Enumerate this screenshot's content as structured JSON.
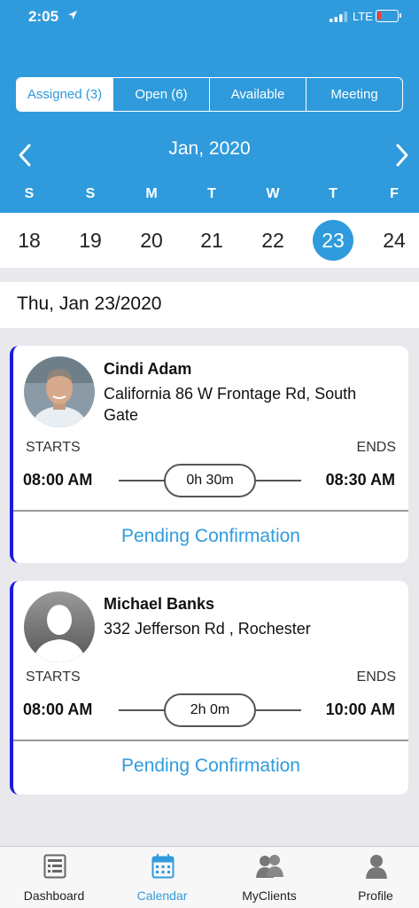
{
  "status_bar": {
    "time": "2:05",
    "carrier": "LTE"
  },
  "colors": {
    "accent": "#2f9bdc",
    "card_edge": "#1a1ae0",
    "battery_low": "#ff3b30"
  },
  "tabs": [
    {
      "label": "Assigned (3)",
      "active": true
    },
    {
      "label": "Open (6)",
      "active": false
    },
    {
      "label": "Available",
      "active": false
    },
    {
      "label": "Meeting",
      "active": false
    }
  ],
  "calendar": {
    "month_label": "Jan, 2020",
    "weekdays": [
      "S",
      "S",
      "M",
      "T",
      "W",
      "T",
      "F"
    ],
    "dates": [
      "18",
      "19",
      "20",
      "21",
      "22",
      "23",
      "24"
    ],
    "selected_date": "23"
  },
  "day_header": "Thu, Jan 23/2020",
  "appointments": [
    {
      "client_name": "Cindi Adam",
      "address": "California 86 W Frontage Rd, South Gate",
      "starts_label": "STARTS",
      "ends_label": "ENDS",
      "start_time": "08:00 AM",
      "end_time": "08:30 AM",
      "duration": "0h 30m",
      "status": "Pending Confirmation"
    },
    {
      "client_name": "Michael Banks",
      "address": "332 Jefferson Rd , Rochester",
      "starts_label": "STARTS",
      "ends_label": "ENDS",
      "start_time": "08:00 AM",
      "end_time": "10:00 AM",
      "duration": "2h 0m",
      "status": "Pending Confirmation"
    }
  ],
  "bottom_nav": [
    {
      "label": "Dashboard",
      "icon": "dashboard-icon",
      "active": false
    },
    {
      "label": "Calendar",
      "icon": "calendar-icon",
      "active": true
    },
    {
      "label": "MyClients",
      "icon": "clients-icon",
      "active": false
    },
    {
      "label": "Profile",
      "icon": "profile-icon",
      "active": false
    }
  ]
}
